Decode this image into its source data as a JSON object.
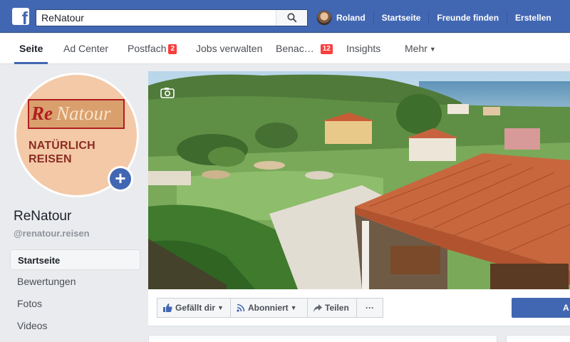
{
  "topbar": {
    "search_value": "ReNatour",
    "user_name": "Roland",
    "nav": [
      "Startseite",
      "Freunde finden",
      "Erstellen"
    ]
  },
  "tabs": {
    "seite": "Seite",
    "ad_center": "Ad Center",
    "postfach": "Postfach",
    "postfach_badge": "2",
    "jobs": "Jobs verwalten",
    "benac": "Benac…",
    "benac_badge": "12",
    "insights": "Insights",
    "mehr": "Mehr"
  },
  "profile": {
    "logo_re": "Re",
    "logo_natour": "Natour",
    "tagline_line1": "NATÜRLICH",
    "tagline_line2": "REISEN",
    "page_name": "ReNatour",
    "handle": "@renatour.reisen"
  },
  "sidebar": {
    "items": [
      "Startseite",
      "Bewertungen",
      "Fotos",
      "Videos"
    ]
  },
  "actions": {
    "like": "Gefällt dir",
    "follow": "Abonniert",
    "share": "Teilen",
    "more": "···",
    "cta": "A"
  },
  "colors": {
    "fb_blue": "#4267b2",
    "badge_red": "#fa3e3e",
    "background": "#e9ebee"
  }
}
